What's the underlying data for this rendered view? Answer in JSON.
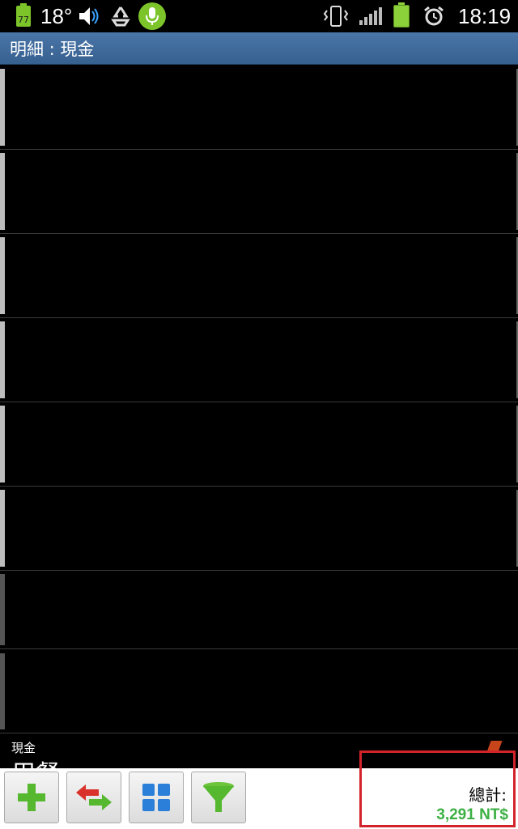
{
  "status_bar": {
    "battery_small_label": "77",
    "temperature": "18°",
    "time": "18:19",
    "icons": [
      "battery-small-icon",
      "volume-icon",
      "recycle-icon",
      "microphone-icon",
      "vibrate-icon",
      "signal-icon",
      "battery-icon",
      "alarm-icon"
    ]
  },
  "header": {
    "title": "明細 : 現金"
  },
  "list": {
    "last_item": {
      "account": "現金",
      "category": "用餐"
    }
  },
  "toolbar": {
    "buttons": [
      {
        "icon": "add-icon"
      },
      {
        "icon": "transfer-icon"
      },
      {
        "icon": "grid-icon"
      },
      {
        "icon": "filter-icon"
      }
    ]
  },
  "summary": {
    "label": "總計:",
    "total": "3,291 NT$"
  },
  "colors": {
    "title_bar": "#3f6c9e",
    "total_green": "#3cb043",
    "highlight_red": "#d2232a"
  }
}
